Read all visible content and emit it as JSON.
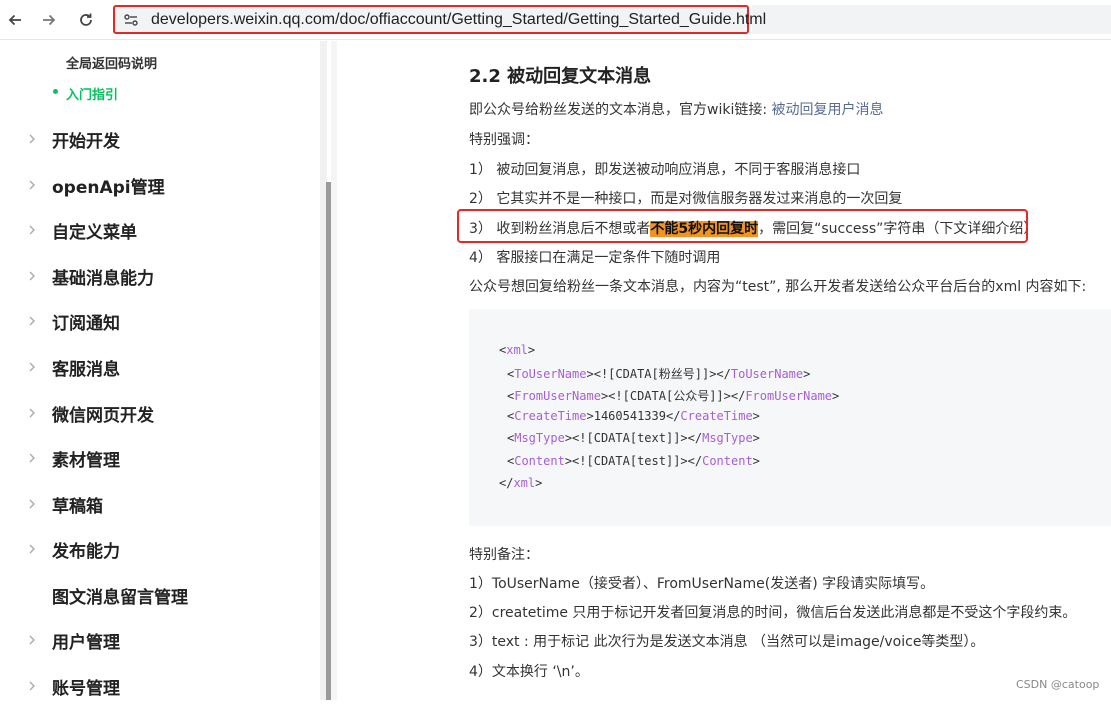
{
  "browser": {
    "url": "developers.weixin.qq.com/doc/offiaccount/Getting_Started/Getting_Started_Guide.html",
    "back_icon": "arrow-left-icon",
    "forward_icon": "arrow-right-icon",
    "reload_icon": "reload-icon",
    "site_info_icon": "tune-icon"
  },
  "sidebar": {
    "sub_items": [
      {
        "label": "全局返回码说明",
        "active": false
      },
      {
        "label": "入门指引",
        "active": true
      }
    ],
    "items": [
      {
        "label": "开始开发",
        "has_children": true
      },
      {
        "label": "openApi管理",
        "has_children": true
      },
      {
        "label": "自定义菜单",
        "has_children": true
      },
      {
        "label": "基础消息能力",
        "has_children": true
      },
      {
        "label": "订阅通知",
        "has_children": true
      },
      {
        "label": "客服消息",
        "has_children": true
      },
      {
        "label": "微信网页开发",
        "has_children": true
      },
      {
        "label": "素材管理",
        "has_children": true
      },
      {
        "label": "草稿箱",
        "has_children": true
      },
      {
        "label": "发布能力",
        "has_children": true
      },
      {
        "label": "图文消息留言管理",
        "has_children": false
      },
      {
        "label": "用户管理",
        "has_children": true
      },
      {
        "label": "账号管理",
        "has_children": true
      }
    ]
  },
  "content": {
    "heading": "2.2 被动回复文本消息",
    "intro_text": "即公众号给粉丝发送的文本消息，官方wiki链接: ",
    "intro_link": "被动回复用户消息",
    "emphasis_title": "特别强调：",
    "points": [
      "1）  被动回复消息，即发送被动响应消息，不同于客服消息接口",
      "2）  它其实并不是一种接口，而是对微信服务器发过来消息的一次回复"
    ],
    "point3_before": "3）  收到粉丝消息后不想或者",
    "point3_highlight": "不能5秒内回复时",
    "point3_after": "，需回复“success”字符串（下文详细介绍）",
    "point4": "4）  客服接口在满足一定条件下随时调用",
    "xml_intro": "公众号想回复给粉丝一条文本消息，内容为“test”, 那么开发者发送给公众平台后台的xml 内容如下:",
    "code": {
      "root_tag": "xml",
      "fields": [
        {
          "tag": "ToUserName",
          "value": "<![CDATA[粉丝号]]>"
        },
        {
          "tag": "FromUserName",
          "value": "<![CDATA[公众号]]>"
        },
        {
          "tag": "CreateTime",
          "value": "1460541339"
        },
        {
          "tag": "MsgType",
          "value": "<![CDATA[text]]>"
        },
        {
          "tag": "Content",
          "value": "<![CDATA[test]]>"
        }
      ]
    },
    "notes_title": "特别备注：",
    "notes": [
      "1）ToUserName（接受者）、FromUserName(发送者) 字段请实际填写。",
      "2）createtime 只用于标记开发者回复消息的时间，微信后台发送此消息都是不受这个字段约束。",
      "3）text : 用于标记 此次行为是发送文本消息 （当然可以是image/voice等类型）。",
      "4）文本换行 ‘\\n’。"
    ]
  },
  "watermark": "CSDN @catoop",
  "colors": {
    "accent_green": "#07c160",
    "highlight_orange": "#f29324",
    "annotation_red": "#e02a2a",
    "link_blue": "#576b95",
    "xml_tag_purple": "#a65fd4"
  }
}
